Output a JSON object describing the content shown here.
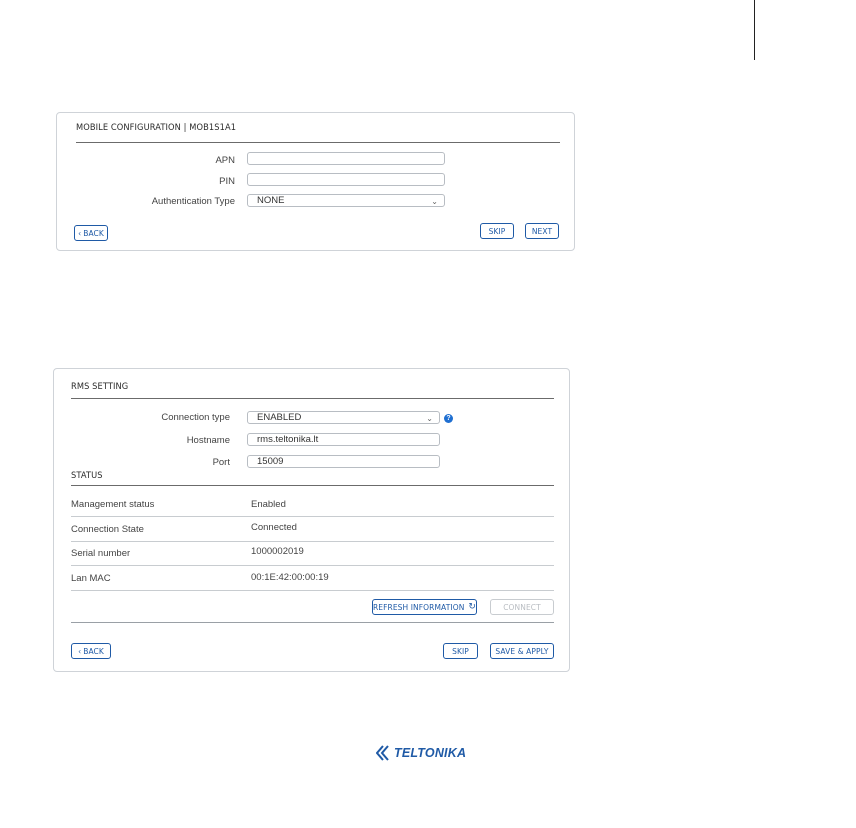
{
  "mobile": {
    "title": "MOBILE CONFIGURATION  | MOB1S1A1",
    "apn_label": "APN",
    "apn_value": "",
    "pin_label": "PIN",
    "pin_value": "",
    "auth_label": "Authentication Type",
    "auth_value": "NONE",
    "back_label": "BACK",
    "skip_label": "SKIP",
    "next_label": "NEXT"
  },
  "rms": {
    "title": "RMS SETTING",
    "conn_type_label": "Connection type",
    "conn_type_value": "ENABLED",
    "hostname_label": "Hostname",
    "hostname_value": "rms.teltonika.lt",
    "port_label": "Port",
    "port_value": "15009",
    "status_title": "STATUS",
    "status_rows": [
      {
        "label": "Management status",
        "value": "Enabled"
      },
      {
        "label": "Connection State",
        "value": "Connected"
      },
      {
        "label": "Serial number",
        "value": "1000002019"
      },
      {
        "label": "Lan MAC",
        "value": "00:1E:42:00:00:19"
      }
    ],
    "refresh_label": "REFRESH INFORMATION",
    "connect_label": "CONNECT",
    "back_label": "BACK",
    "skip_label": "SKIP",
    "save_label": "SAVE & APPLY"
  },
  "footer": {
    "logo_text": "TELTONIKA"
  },
  "colors": {
    "accent": "#1f5aa6",
    "help": "#1f6fd1",
    "border": "#cfd3d8"
  }
}
